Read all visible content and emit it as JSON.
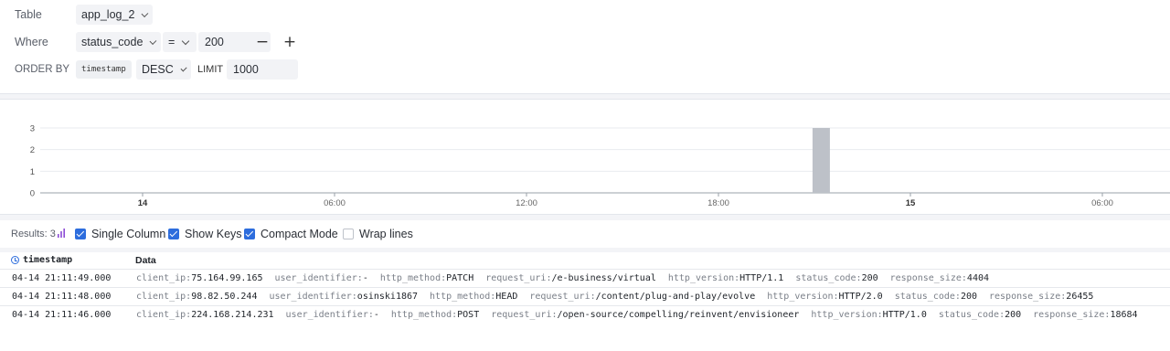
{
  "query": {
    "table_label": "Table",
    "table_value": "app_log_2",
    "where_label": "Where",
    "where_field": "status_code",
    "where_operator": "=",
    "where_value": "200",
    "remove_icon": "minus-icon",
    "add_icon": "plus-icon",
    "order_label": "ORDER BY",
    "order_field": "timestamp",
    "order_dir": "DESC",
    "limit_label": "LIMIT",
    "limit_value": "1000"
  },
  "chart_data": {
    "type": "bar",
    "y_ticks": [
      "3",
      "2",
      "1",
      "0"
    ],
    "ylim": [
      0,
      3
    ],
    "x_ticks": [
      "14",
      "06:00",
      "12:00",
      "18:00",
      "15",
      "06:00"
    ],
    "bars": [
      {
        "x": "04-14 21:11",
        "value": 3
      }
    ],
    "bar_color": "#bdc1c8"
  },
  "results": {
    "label": "Results: 3",
    "options": [
      {
        "label": "Single Column",
        "checked": true
      },
      {
        "label": "Show Keys",
        "checked": true
      },
      {
        "label": "Compact Mode",
        "checked": true
      },
      {
        "label": "Wrap lines",
        "checked": false
      }
    ]
  },
  "table": {
    "columns": [
      "timestamp",
      "Data"
    ],
    "rows": [
      {
        "timestamp": "04-14 21:11:49.000",
        "fields": [
          {
            "k": "client_ip:",
            "v": "75.164.99.165"
          },
          {
            "k": "user_identifier:",
            "v": "-"
          },
          {
            "k": "http_method:",
            "v": "PATCH"
          },
          {
            "k": "request_uri:",
            "v": "/e-business/virtual"
          },
          {
            "k": "http_version:",
            "v": "HTTP/1.1"
          },
          {
            "k": "status_code:",
            "v": "200"
          },
          {
            "k": "response_size:",
            "v": "4404"
          }
        ]
      },
      {
        "timestamp": "04-14 21:11:48.000",
        "fields": [
          {
            "k": "client_ip:",
            "v": "98.82.50.244"
          },
          {
            "k": "user_identifier:",
            "v": "osinski1867"
          },
          {
            "k": "http_method:",
            "v": "HEAD"
          },
          {
            "k": "request_uri:",
            "v": "/content/plug-and-play/evolve"
          },
          {
            "k": "http_version:",
            "v": "HTTP/2.0"
          },
          {
            "k": "status_code:",
            "v": "200"
          },
          {
            "k": "response_size:",
            "v": "26455"
          }
        ]
      },
      {
        "timestamp": "04-14 21:11:46.000",
        "fields": [
          {
            "k": "client_ip:",
            "v": "224.168.214.231"
          },
          {
            "k": "user_identifier:",
            "v": "-"
          },
          {
            "k": "http_method:",
            "v": "POST"
          },
          {
            "k": "request_uri:",
            "v": "/open-source/compelling/reinvent/envisioneer"
          },
          {
            "k": "http_version:",
            "v": "HTTP/1.0"
          },
          {
            "k": "status_code:",
            "v": "200"
          },
          {
            "k": "response_size:",
            "v": "18684"
          }
        ]
      }
    ]
  }
}
